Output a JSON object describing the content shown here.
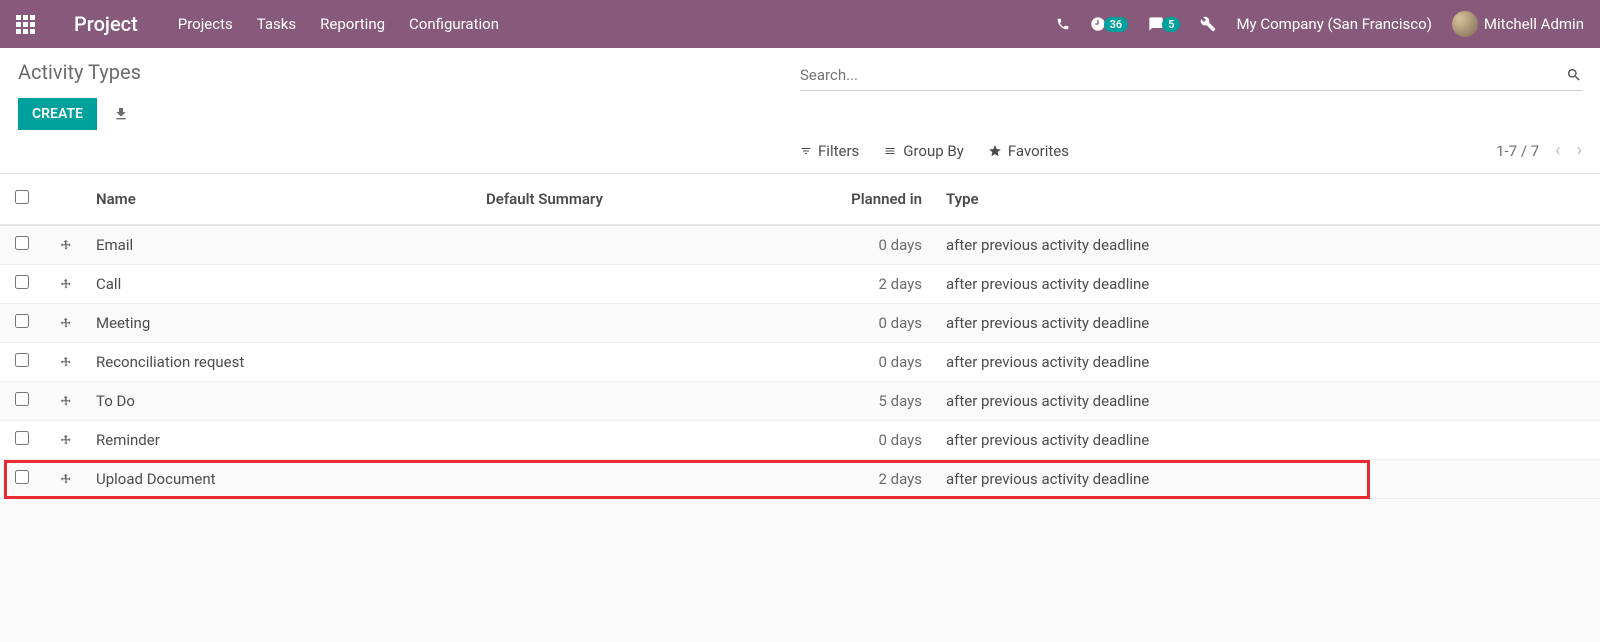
{
  "header": {
    "brand": "Project",
    "menu": [
      "Projects",
      "Tasks",
      "Reporting",
      "Configuration"
    ],
    "clock_badge": "36",
    "chat_badge": "5",
    "company": "My Company (San Francisco)",
    "user": "Mitchell Admin"
  },
  "page": {
    "title": "Activity Types",
    "create_label": "CREATE",
    "search_placeholder": "Search...",
    "filters_label": "Filters",
    "groupby_label": "Group By",
    "favorites_label": "Favorites",
    "pager": "1-7 / 7"
  },
  "columns": {
    "name": "Name",
    "summary": "Default Summary",
    "planned": "Planned in",
    "type": "Type"
  },
  "rows": [
    {
      "name": "Email",
      "summary": "",
      "planned": "0 days",
      "type": "after previous activity deadline"
    },
    {
      "name": "Call",
      "summary": "",
      "planned": "2 days",
      "type": "after previous activity deadline"
    },
    {
      "name": "Meeting",
      "summary": "",
      "planned": "0 days",
      "type": "after previous activity deadline"
    },
    {
      "name": "Reconciliation request",
      "summary": "",
      "planned": "0 days",
      "type": "after previous activity deadline"
    },
    {
      "name": "To Do",
      "summary": "",
      "planned": "5 days",
      "type": "after previous activity deadline"
    },
    {
      "name": "Reminder",
      "summary": "",
      "planned": "0 days",
      "type": "after previous activity deadline"
    },
    {
      "name": "Upload Document",
      "summary": "",
      "planned": "2 days",
      "type": "after previous activity deadline"
    }
  ],
  "highlight_index": 6
}
